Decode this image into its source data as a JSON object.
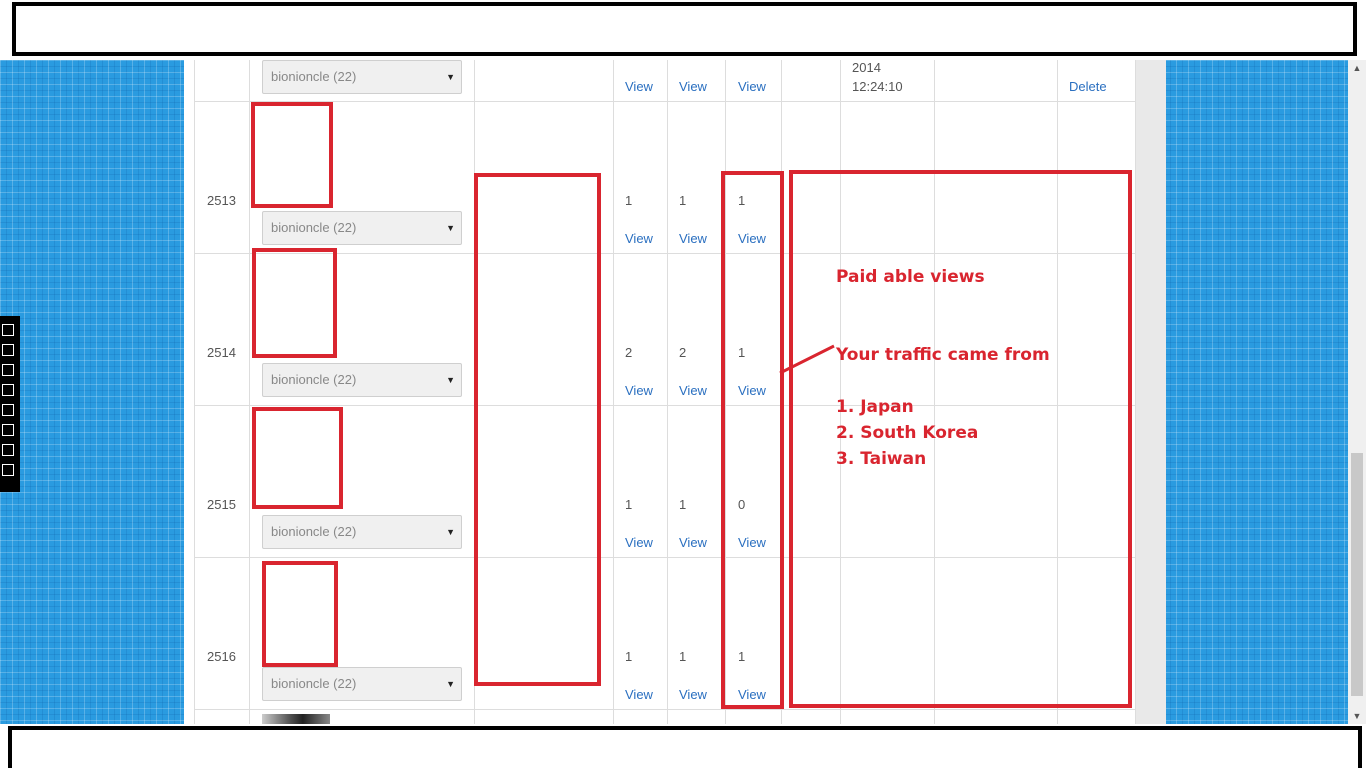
{
  "table": {
    "top_row": {
      "date": "2014",
      "time": "12:24:10",
      "delete_label": "Delete",
      "select_value": "bionioncle (22)",
      "views": [
        "View",
        "View",
        "View"
      ]
    },
    "rows": [
      {
        "id": "2513",
        "select_value": "bionioncle (22)",
        "c1": "1",
        "c2": "1",
        "c3": "1",
        "view1": "View",
        "view2": "View",
        "view3": "View"
      },
      {
        "id": "2514",
        "select_value": "bionioncle (22)",
        "c1": "2",
        "c2": "2",
        "c3": "1",
        "view1": "View",
        "view2": "View",
        "view3": "View"
      },
      {
        "id": "2515",
        "select_value": "bionioncle (22)",
        "c1": "1",
        "c2": "1",
        "c3": "0",
        "view1": "View",
        "view2": "View",
        "view3": "View"
      },
      {
        "id": "2516",
        "select_value": "bionioncle (22)",
        "c1": "1",
        "c2": "1",
        "c3": "1",
        "view1": "View",
        "view2": "View",
        "view3": "View"
      }
    ]
  },
  "annotation": {
    "heading": "Paid able views",
    "subheading": "Your traffic came from",
    "countries": [
      "1. Japan",
      "2. South Korea",
      "3. Taiwan"
    ]
  },
  "colors": {
    "annotation_red": "#d9252f",
    "link_blue": "#2a6fc0",
    "page_bg": "#2a9be0"
  },
  "icons": {
    "select_arrow": "triangle-down-icon",
    "scroll_up": "triangle-up-icon",
    "scroll_down": "triangle-down-icon"
  }
}
